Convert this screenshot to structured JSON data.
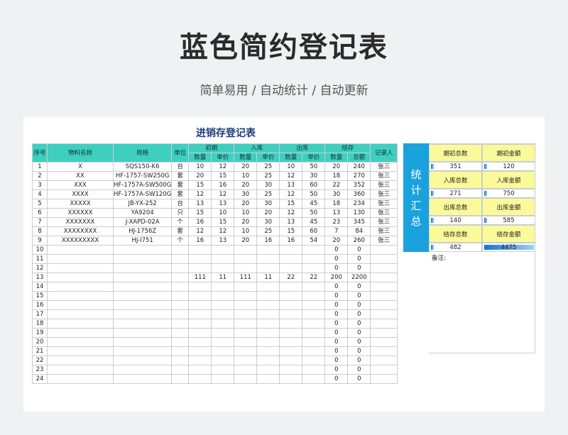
{
  "title": "蓝色简约登记表",
  "subtitle": "简单易用 / 自动统计 / 自动更新",
  "sheet_title": "进销存登记表",
  "headers": {
    "seq": "序号",
    "name": "物料名称",
    "spec": "规格",
    "unit": "单位",
    "opening": "初期",
    "inbound": "入库",
    "outbound": "出库",
    "balance": "结存",
    "qty": "数量",
    "price": "单价",
    "total": "总额",
    "recorder": "记录人"
  },
  "rows": [
    {
      "seq": "1",
      "name": "X",
      "spec": "SQS150-K6",
      "unit": "台",
      "oq": "10",
      "op": "12",
      "iq": "20",
      "ip": "25",
      "xq": "10",
      "xp": "50",
      "bq": "20",
      "bt": "240",
      "rec": "张三"
    },
    {
      "seq": "2",
      "name": "XX",
      "spec": "HF-1757-SW250G",
      "unit": "套",
      "oq": "20",
      "op": "15",
      "iq": "10",
      "ip": "25",
      "xq": "12",
      "xp": "30",
      "bq": "18",
      "bt": "270",
      "rec": "张三"
    },
    {
      "seq": "3",
      "name": "XXX",
      "spec": "HF-1757A-SW500G",
      "unit": "套",
      "oq": "15",
      "op": "16",
      "iq": "20",
      "ip": "30",
      "xq": "13",
      "xp": "60",
      "bq": "22",
      "bt": "352",
      "rec": "张三"
    },
    {
      "seq": "4",
      "name": "XXXX",
      "spec": "HF-1757A-SW120G",
      "unit": "套",
      "oq": "12",
      "op": "12",
      "iq": "30",
      "ip": "25",
      "xq": "12",
      "xp": "50",
      "bq": "30",
      "bt": "360",
      "rec": "张三"
    },
    {
      "seq": "5",
      "name": "XXXXX",
      "spec": "JB-YX-252",
      "unit": "台",
      "oq": "13",
      "op": "13",
      "iq": "20",
      "ip": "30",
      "xq": "15",
      "xp": "45",
      "bq": "18",
      "bt": "234",
      "rec": "张三"
    },
    {
      "seq": "6",
      "name": "XXXXXX",
      "spec": "YA9204",
      "unit": "只",
      "oq": "15",
      "op": "10",
      "iq": "10",
      "ip": "20",
      "xq": "12",
      "xp": "50",
      "bq": "13",
      "bt": "130",
      "rec": "张三"
    },
    {
      "seq": "7",
      "name": "XXXXXXX",
      "spec": "J-XAPD-02A",
      "unit": "个",
      "oq": "16",
      "op": "15",
      "iq": "20",
      "ip": "30",
      "xq": "13",
      "xp": "45",
      "bq": "23",
      "bt": "345",
      "rec": "张三"
    },
    {
      "seq": "8",
      "name": "XXXXXXXX",
      "spec": "HJ-1756Z",
      "unit": "套",
      "oq": "12",
      "op": "12",
      "iq": "10",
      "ip": "25",
      "xq": "15",
      "xp": "60",
      "bq": "7",
      "bt": "84",
      "rec": "张三"
    },
    {
      "seq": "9",
      "name": "XXXXXXXXX",
      "spec": "HJ-I751",
      "unit": "个",
      "oq": "16",
      "op": "13",
      "iq": "20",
      "ip": "16",
      "xq": "16",
      "xp": "54",
      "bq": "20",
      "bt": "260",
      "rec": "张三"
    },
    {
      "seq": "10",
      "name": "",
      "spec": "",
      "unit": "",
      "oq": "",
      "op": "",
      "iq": "",
      "ip": "",
      "xq": "",
      "xp": "",
      "bq": "0",
      "bt": "0",
      "rec": ""
    },
    {
      "seq": "11",
      "name": "",
      "spec": "",
      "unit": "",
      "oq": "",
      "op": "",
      "iq": "",
      "ip": "",
      "xq": "",
      "xp": "",
      "bq": "0",
      "bt": "0",
      "rec": ""
    },
    {
      "seq": "12",
      "name": "",
      "spec": "",
      "unit": "",
      "oq": "",
      "op": "",
      "iq": "",
      "ip": "",
      "xq": "",
      "xp": "",
      "bq": "0",
      "bt": "0",
      "rec": ""
    },
    {
      "seq": "13",
      "name": "",
      "spec": "",
      "unit": "",
      "oq": "111",
      "op": "11",
      "iq": "111",
      "ip": "11",
      "xq": "22",
      "xp": "22",
      "bq": "200",
      "bt": "2200",
      "rec": ""
    },
    {
      "seq": "14",
      "name": "",
      "spec": "",
      "unit": "",
      "oq": "",
      "op": "",
      "iq": "",
      "ip": "",
      "xq": "",
      "xp": "",
      "bq": "0",
      "bt": "0",
      "rec": ""
    },
    {
      "seq": "15",
      "name": "",
      "spec": "",
      "unit": "",
      "oq": "",
      "op": "",
      "iq": "",
      "ip": "",
      "xq": "",
      "xp": "",
      "bq": "0",
      "bt": "0",
      "rec": ""
    },
    {
      "seq": "16",
      "name": "",
      "spec": "",
      "unit": "",
      "oq": "",
      "op": "",
      "iq": "",
      "ip": "",
      "xq": "",
      "xp": "",
      "bq": "0",
      "bt": "0",
      "rec": ""
    },
    {
      "seq": "17",
      "name": "",
      "spec": "",
      "unit": "",
      "oq": "",
      "op": "",
      "iq": "",
      "ip": "",
      "xq": "",
      "xp": "",
      "bq": "0",
      "bt": "0",
      "rec": ""
    },
    {
      "seq": "18",
      "name": "",
      "spec": "",
      "unit": "",
      "oq": "",
      "op": "",
      "iq": "",
      "ip": "",
      "xq": "",
      "xp": "",
      "bq": "0",
      "bt": "0",
      "rec": ""
    },
    {
      "seq": "19",
      "name": "",
      "spec": "",
      "unit": "",
      "oq": "",
      "op": "",
      "iq": "",
      "ip": "",
      "xq": "",
      "xp": "",
      "bq": "0",
      "bt": "0",
      "rec": ""
    },
    {
      "seq": "20",
      "name": "",
      "spec": "",
      "unit": "",
      "oq": "",
      "op": "",
      "iq": "",
      "ip": "",
      "xq": "",
      "xp": "",
      "bq": "0",
      "bt": "0",
      "rec": ""
    },
    {
      "seq": "21",
      "name": "",
      "spec": "",
      "unit": "",
      "oq": "",
      "op": "",
      "iq": "",
      "ip": "",
      "xq": "",
      "xp": "",
      "bq": "0",
      "bt": "0",
      "rec": ""
    },
    {
      "seq": "22",
      "name": "",
      "spec": "",
      "unit": "",
      "oq": "",
      "op": "",
      "iq": "",
      "ip": "",
      "xq": "",
      "xp": "",
      "bq": "0",
      "bt": "0",
      "rec": ""
    },
    {
      "seq": "23",
      "name": "",
      "spec": "",
      "unit": "",
      "oq": "",
      "op": "",
      "iq": "",
      "ip": "",
      "xq": "",
      "xp": "",
      "bq": "0",
      "bt": "0",
      "rec": ""
    },
    {
      "seq": "24",
      "name": "",
      "spec": "",
      "unit": "",
      "oq": "",
      "op": "",
      "iq": "",
      "ip": "",
      "xq": "",
      "xp": "",
      "bq": "0",
      "bt": "0",
      "rec": ""
    }
  ],
  "summary": {
    "side_label": [
      "统",
      "计",
      "汇",
      "总"
    ],
    "items": [
      {
        "label": "期初总数",
        "value": "351",
        "fill": 0.06
      },
      {
        "label": "期初金额",
        "value": "120",
        "fill": 0.06
      },
      {
        "label": "入库总数",
        "value": "271",
        "fill": 0.06
      },
      {
        "label": "入库金额",
        "value": "750",
        "fill": 0.06
      },
      {
        "label": "出库总数",
        "value": "140",
        "fill": 0.06
      },
      {
        "label": "出库金额",
        "value": "585",
        "fill": 0.06
      },
      {
        "label": "结存总数",
        "value": "482",
        "fill": 0.06
      },
      {
        "label": "结存金额",
        "value": "4475",
        "fill": 1.0
      }
    ],
    "note_label": "备注:"
  },
  "colors": {
    "header": "#3ecfc1",
    "summary_bar": "#1aa2dc",
    "label_bg": "#fbfa9b",
    "title_blue": "#1a3c7a"
  }
}
